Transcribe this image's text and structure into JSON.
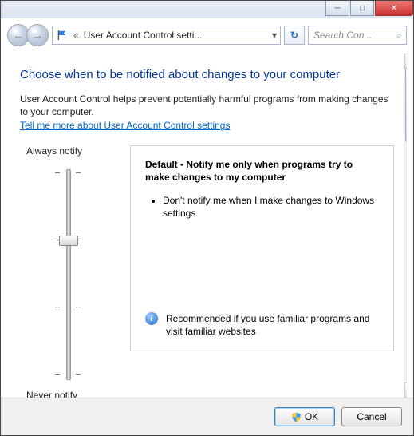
{
  "titlebar": {
    "min": "─",
    "max": "□",
    "close": "✕"
  },
  "toolbar": {
    "back": "←",
    "fwd": "→",
    "chev": "«",
    "crumb_text": "User Account Control setti...",
    "dropdown": "▾",
    "refresh": "↻⇄",
    "search_placeholder": "Search Con...",
    "search_icon": "⌕"
  },
  "heading": "Choose when to be notified about changes to your computer",
  "intro": "User Account Control helps prevent potentially harmful programs from making changes to your computer.",
  "link": "Tell me more about User Account Control settings",
  "slider": {
    "top_label": "Always notify",
    "bottom_label": "Never notify"
  },
  "panel": {
    "title": "Default - Notify me only when programs try to make changes to my computer",
    "bullet": "Don't notify me when I make changes to Windows settings",
    "reco": "Recommended if you use familiar programs and visit familiar websites"
  },
  "buttons": {
    "ok": "OK",
    "cancel": "Cancel"
  }
}
